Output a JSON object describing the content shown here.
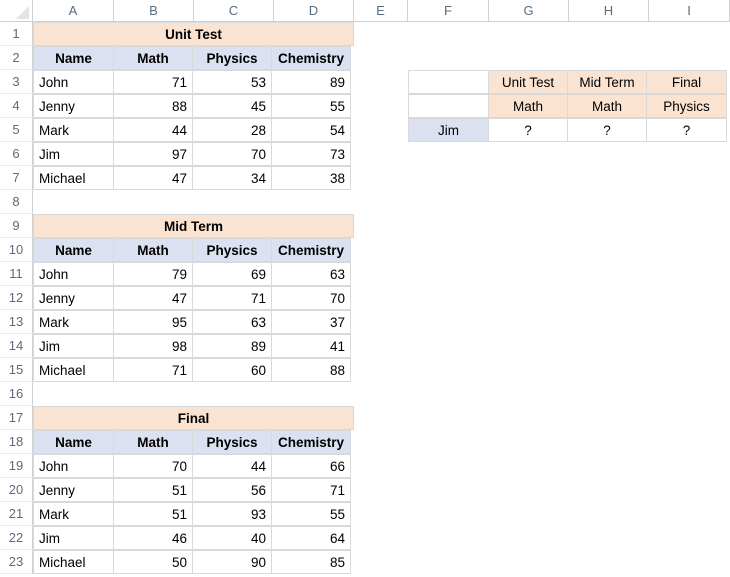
{
  "app": {
    "type": "spreadsheet",
    "select_all_icon": "select-all-triangle-icon"
  },
  "grid": {
    "column_headers": [
      "A",
      "B",
      "C",
      "D",
      "E",
      "F",
      "G",
      "H",
      "I"
    ],
    "row_numbers": [
      "1",
      "2",
      "3",
      "4",
      "5",
      "6",
      "7",
      "8",
      "9",
      "10",
      "11",
      "12",
      "13",
      "14",
      "15",
      "16",
      "17",
      "18",
      "19",
      "20",
      "21",
      "22",
      "23"
    ],
    "colors": {
      "title_fill": "#fbe3d1",
      "header_fill": "#dce1f1",
      "cell_border": "#d9d9d9",
      "gridline": "#ebebeb",
      "header_text": "#5a6b80",
      "body_text": "#000000"
    }
  },
  "tables": {
    "unit_test": {
      "title": "Unit Test",
      "title_row": "1",
      "columns": [
        "Name",
        "Math",
        "Physics",
        "Chemistry"
      ],
      "rows": [
        {
          "row": "3",
          "name": "John",
          "math": "71",
          "physics": "53",
          "chemistry": "89"
        },
        {
          "row": "4",
          "name": "Jenny",
          "math": "88",
          "physics": "45",
          "chemistry": "55"
        },
        {
          "row": "5",
          "name": "Mark",
          "math": "44",
          "physics": "28",
          "chemistry": "54"
        },
        {
          "row": "6",
          "name": "Jim",
          "math": "97",
          "physics": "70",
          "chemistry": "73"
        },
        {
          "row": "7",
          "name": "Michael",
          "math": "47",
          "physics": "34",
          "chemistry": "38"
        }
      ]
    },
    "mid_term": {
      "title": "Mid Term",
      "title_row": "9",
      "columns": [
        "Name",
        "Math",
        "Physics",
        "Chemistry"
      ],
      "rows": [
        {
          "row": "11",
          "name": "John",
          "math": "79",
          "physics": "69",
          "chemistry": "63"
        },
        {
          "row": "12",
          "name": "Jenny",
          "math": "47",
          "physics": "71",
          "chemistry": "70"
        },
        {
          "row": "13",
          "name": "Mark",
          "math": "95",
          "physics": "63",
          "chemistry": "37"
        },
        {
          "row": "14",
          "name": "Jim",
          "math": "98",
          "physics": "89",
          "chemistry": "41"
        },
        {
          "row": "15",
          "name": "Michael",
          "math": "71",
          "physics": "60",
          "chemistry": "88"
        }
      ]
    },
    "final": {
      "title": "Final",
      "title_row": "17",
      "columns": [
        "Name",
        "Math",
        "Physics",
        "Chemistry"
      ],
      "rows": [
        {
          "row": "19",
          "name": "John",
          "math": "70",
          "physics": "44",
          "chemistry": "66"
        },
        {
          "row": "20",
          "name": "Jenny",
          "math": "51",
          "physics": "56",
          "chemistry": "71"
        },
        {
          "row": "21",
          "name": "Mark",
          "math": "51",
          "physics": "93",
          "chemistry": "55"
        },
        {
          "row": "22",
          "name": "Jim",
          "math": "46",
          "physics": "40",
          "chemistry": "64"
        },
        {
          "row": "23",
          "name": "Michael",
          "math": "50",
          "physics": "90",
          "chemistry": "85"
        }
      ]
    },
    "lookup": {
      "corner_top": "",
      "corner_mid": "",
      "exam_headers": [
        "Unit Test",
        "Mid Term",
        "Final"
      ],
      "subject_headers": [
        "Math",
        "Math",
        "Physics"
      ],
      "student": "Jim",
      "values": [
        "?",
        "?",
        "?"
      ]
    }
  }
}
